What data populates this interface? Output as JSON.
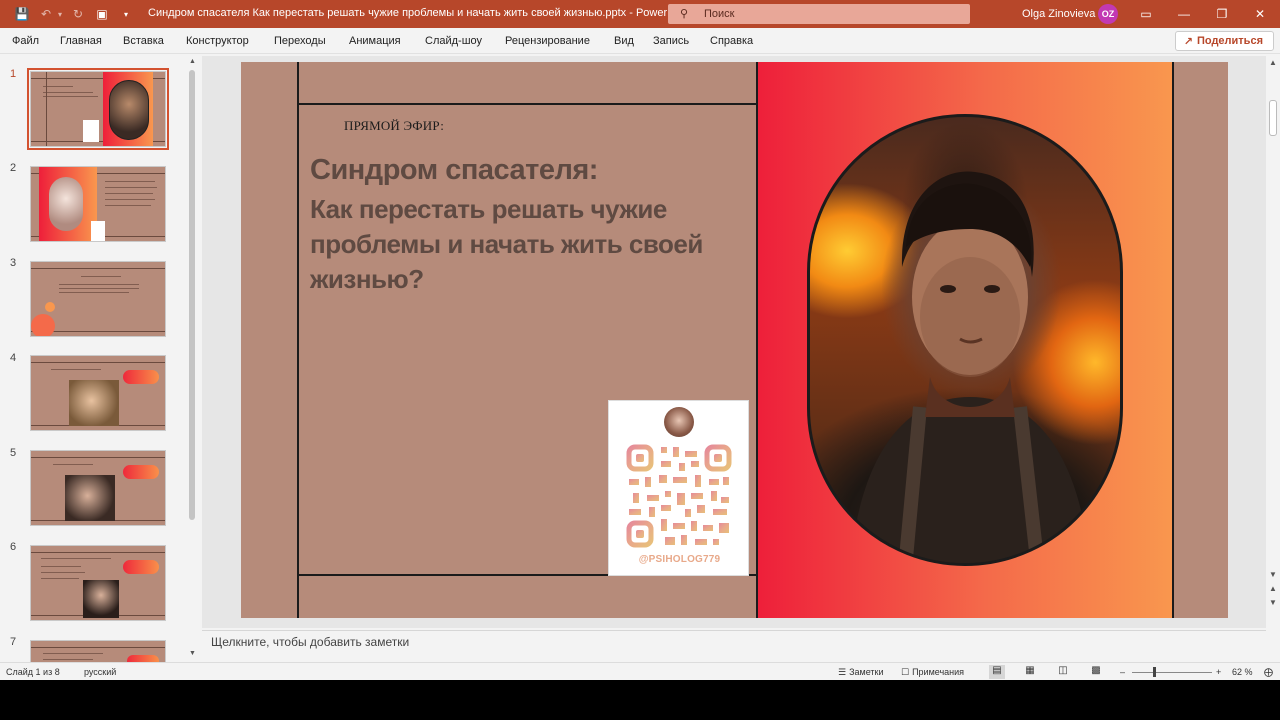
{
  "titlebar": {
    "doc_title": "Синдром спасателя Как перестать решать чужие проблемы и начать жить своей жизнью.pptx  -  PowerPoint",
    "search_placeholder": "Поиск",
    "user_name": "Olga Zinovieva",
    "user_initials": "OZ",
    "accent_color": "#b7472a"
  },
  "menu": {
    "items": [
      "Файл",
      "Главная",
      "Вставка",
      "Конструктор",
      "Переходы",
      "Анимация",
      "Слайд-шоу",
      "Рецензирование",
      "Вид",
      "Запись",
      "Справка"
    ],
    "share_label": "Поделиться"
  },
  "thumbnails": {
    "numbers": [
      "1",
      "2",
      "3",
      "4",
      "5",
      "6",
      "7"
    ],
    "active_index": 1
  },
  "slide": {
    "kicker": "ПРЯМОЙ ЭФИР:",
    "heading": "Синдром спасателя:",
    "subheading": "Как перестать решать чужие проблемы и начать жить своей жизнью?",
    "qr_handle": "@PSIHOLOG779",
    "background_color": "#b68b7a",
    "gradient_colors": [
      "#ee1f3a",
      "#f9974e"
    ]
  },
  "notes": {
    "placeholder": "Щелкните, чтобы добавить заметки"
  },
  "status": {
    "slide_info": "Слайд 1 из 8",
    "language": "русский",
    "notes_label": "Заметки",
    "comments_label": "Примечания",
    "zoom": "62 %"
  }
}
